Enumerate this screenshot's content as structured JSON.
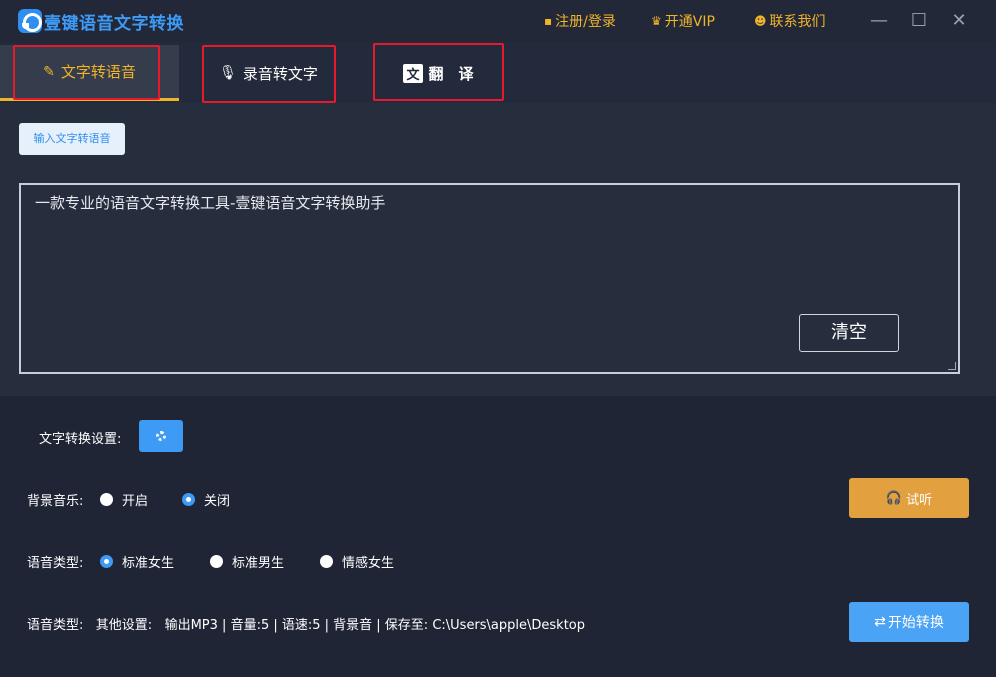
{
  "app": {
    "title": "壹键语音文字转换"
  },
  "top_links": {
    "register_login": "注册/登录",
    "vip": "开通VIP",
    "contact": "联系我们"
  },
  "window_controls": {
    "minimize": "—",
    "maximize": "☐",
    "close": "✕"
  },
  "tabs": [
    {
      "label": "文字转语音",
      "icon": "text-to-speech-icon",
      "active": true
    },
    {
      "label": "录音转文字",
      "icon": "microphone-icon",
      "active": false
    },
    {
      "label": "翻　译",
      "icon": "translate-icon",
      "active": false
    }
  ],
  "editor": {
    "input_button_label": "输入文字转语音",
    "text_value": "一款专业的语音文字转换工具-壹键语音文字转换助手",
    "clear_button_label": "清空"
  },
  "settings": {
    "conversion_settings_label": "文字转换设置:",
    "bg_music": {
      "label": "背景音乐:",
      "options": [
        {
          "label": "开启",
          "checked": false
        },
        {
          "label": "关闭",
          "checked": true
        }
      ]
    },
    "voice_type": {
      "label": "语音类型:",
      "options": [
        {
          "label": "标准女生",
          "checked": true
        },
        {
          "label": "标准男生",
          "checked": false
        },
        {
          "label": "情感女生",
          "checked": false
        }
      ]
    },
    "listen_button_label": "试听",
    "status": {
      "label": "语音类型:",
      "other_label": "其他设置:",
      "summary": "输出MP3 |  音量:5 |  语速:5 |  背景音 |  保存至: C:\\Users\\apple\\Desktop"
    },
    "start_button_label": "开始转换"
  },
  "colors": {
    "accent_blue": "#3d9af5",
    "accent_gold": "#f0b429",
    "listen_orange": "#e3a03e",
    "highlight_red": "#e8192c",
    "background": "#1f2535"
  }
}
